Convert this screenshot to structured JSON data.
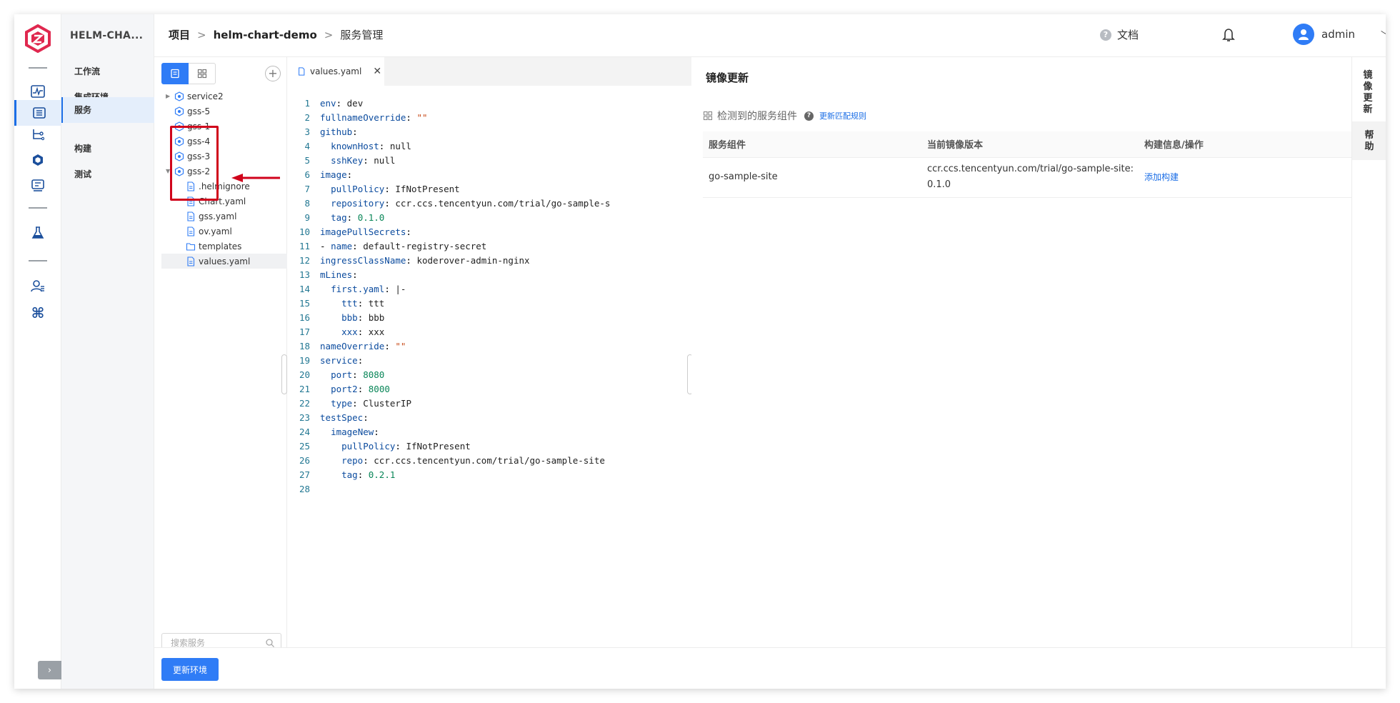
{
  "header": {
    "breadcrumb": {
      "root": "项目",
      "sep1": ">",
      "project": "helm-chart-demo",
      "sep2": ">",
      "current": "服务管理"
    },
    "docs_label": "文档",
    "user_name": "admin"
  },
  "subnav": {
    "project_name": "HELM-CHA...",
    "items": [
      {
        "label": "工作流"
      },
      {
        "label": "集成环境"
      },
      {
        "label": "服务"
      },
      {
        "label": "构建"
      },
      {
        "label": "测试"
      }
    ]
  },
  "tree": {
    "nodes": [
      {
        "label": "service2"
      },
      {
        "label": "gss-5"
      },
      {
        "label": "gss-1"
      },
      {
        "label": "gss-4"
      },
      {
        "label": "gss-3"
      },
      {
        "label": "gss-2"
      },
      {
        "label": ".helmignore"
      },
      {
        "label": "Chart.yaml"
      },
      {
        "label": "gss.yaml"
      },
      {
        "label": "ov.yaml"
      },
      {
        "label": "templates"
      },
      {
        "label": "values.yaml"
      }
    ],
    "search_placeholder": "搜索服务"
  },
  "editor": {
    "tab_label": "values.yaml",
    "lines": [
      {
        "n": "1",
        "k": "env",
        "rest": "dev"
      },
      {
        "n": "2",
        "k": "fullnameOverride"
      },
      {
        "n": "3",
        "k": "github"
      },
      {
        "n": "4",
        "k": "knownHost"
      },
      {
        "n": "5",
        "k": "sshKey"
      },
      {
        "n": "6",
        "k": "image"
      },
      {
        "n": "7",
        "k": "pullPolicy"
      },
      {
        "n": "8",
        "k": "repository"
      },
      {
        "n": "9",
        "k": "tag"
      },
      {
        "n": "10",
        "k": "imagePullSecrets"
      },
      {
        "n": "11",
        "k": "name"
      },
      {
        "n": "12",
        "k": "ingressClassName"
      },
      {
        "n": "13",
        "k": "mLines"
      },
      {
        "n": "14",
        "k": "first.yaml"
      },
      {
        "n": "15",
        "k": "ttt"
      },
      {
        "n": "16",
        "k": "bbb"
      },
      {
        "n": "17",
        "k": "xxx"
      },
      {
        "n": "18",
        "k": "nameOverride"
      },
      {
        "n": "19",
        "k": "service"
      },
      {
        "n": "20",
        "k": "port"
      },
      {
        "n": "21",
        "k": "port2"
      },
      {
        "n": "22",
        "k": "type"
      },
      {
        "n": "23",
        "k": "testSpec"
      },
      {
        "n": "24",
        "k": "imageNew"
      },
      {
        "n": "25",
        "k": "pullPolicy"
      },
      {
        "n": "26",
        "k": "repo"
      },
      {
        "n": "27",
        "k": "tag"
      },
      {
        "n": "28",
        "k": ""
      }
    ],
    "values": {
      "env": "dev",
      "fullnameOverride": "\"\"",
      "knownHost": "null",
      "sshKey": "null",
      "pullPolicy": "IfNotPresent",
      "repository": "ccr.ccs.tencentyun.com/trial/go-sample-s",
      "tag1": "0.1.0",
      "name": "default-registry-secret",
      "ingressClassName": "koderover-admin-nginx",
      "firstyaml": "|-",
      "ttt": "ttt",
      "bbb": "bbb",
      "xxx": "xxx",
      "nameOverride": "\"\"",
      "port": "8080",
      "port2": "8000",
      "type": "ClusterIP",
      "pullPolicy2": "IfNotPresent",
      "repo": "ccr.ccs.tencentyun.com/trial/go-sample-site",
      "tag2": "0.2.1"
    }
  },
  "image_panel": {
    "title": "镜像更新",
    "detected_label": "检测到的服务组件",
    "rule_link": "更新匹配规则",
    "columns": [
      "服务组件",
      "当前镜像版本",
      "构建信息/操作"
    ],
    "rows": [
      {
        "component": "go-sample-site",
        "image_line1": "ccr.ccs.tencentyun.com/trial/go-sample-site:",
        "image_line2": "0.1.0",
        "action": "添加构建"
      }
    ]
  },
  "vtabs": {
    "tab1": "镜像更新",
    "tab2": "帮助"
  },
  "footer": {
    "update_button": "更新环境"
  },
  "colors": {
    "accent": "#2f7cf6",
    "annotation_red": "#d0021b",
    "logo_red": "#e0284f"
  }
}
